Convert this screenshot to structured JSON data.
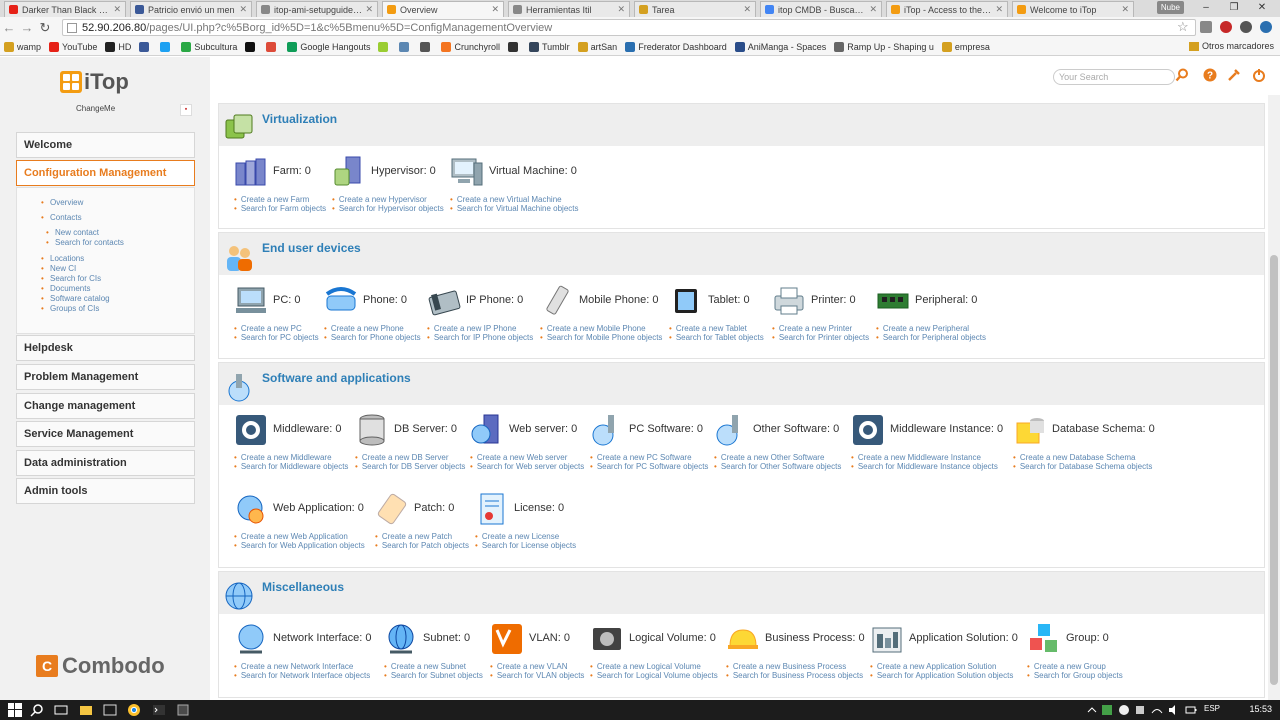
{
  "browser": {
    "tabs": [
      {
        "label": "Darker Than Black Oper",
        "color": "#e62117"
      },
      {
        "label": "Patricio envió un men",
        "color": "#3b5998"
      },
      {
        "label": "itop-ami-setupguide.pdf",
        "color": "#888888"
      },
      {
        "label": "Overview",
        "color": "#f39c12"
      },
      {
        "label": "Herramientas Itil",
        "color": "#888888"
      },
      {
        "label": "Tarea",
        "color": "#d4a020"
      },
      {
        "label": "itop CMDB - Buscar con",
        "color": "#4285f4"
      },
      {
        "label": "iTop - Access to the Der",
        "color": "#f39c12"
      },
      {
        "label": "Welcome to iTop",
        "color": "#f39c12"
      }
    ],
    "active_tab": 3,
    "user_chip": "Nube",
    "url_host": "52.90.206.80",
    "url_path": "/pages/UI.php?c%5Borg_id%5D=1&c%5Bmenu%5D=ConfigManagementOverview",
    "bookmarks": [
      {
        "label": "wamp",
        "color": "#d4a020"
      },
      {
        "label": "YouTube",
        "color": "#e62117"
      },
      {
        "label": "HD",
        "color": "#222222"
      },
      {
        "label": "",
        "color": "#3b5998"
      },
      {
        "label": "",
        "color": "#1da1f2"
      },
      {
        "label": "Subcultura",
        "color": "#2aa845"
      },
      {
        "label": "",
        "color": "#111111"
      },
      {
        "label": "",
        "color": "#dd4b39"
      },
      {
        "label": "Google Hangouts",
        "color": "#0f9d58"
      },
      {
        "label": "",
        "color": "#9acd32"
      },
      {
        "label": "",
        "color": "#5c87b2"
      },
      {
        "label": "",
        "color": "#555555"
      },
      {
        "label": "Crunchyroll",
        "color": "#f47521"
      },
      {
        "label": "",
        "color": "#333333"
      },
      {
        "label": "Tumblr",
        "color": "#35465c"
      },
      {
        "label": "artSan",
        "color": "#d4a020"
      },
      {
        "label": "Frederator Dashboard",
        "color": "#2a6fb0"
      },
      {
        "label": "AniManga - Spaces",
        "color": "#2a4d8a"
      },
      {
        "label": "Ramp Up - Shaping u",
        "color": "#666666"
      },
      {
        "label": "empresa",
        "color": "#d4a020"
      }
    ],
    "other_bookmarks": "Otros marcadores"
  },
  "sidebar": {
    "logo_text": "iTop",
    "org_name": "ChangeMe",
    "menus": [
      {
        "label": "Welcome",
        "active": false
      },
      {
        "label": "Configuration Management",
        "active": true
      },
      {
        "label": "Helpdesk",
        "active": false
      },
      {
        "label": "Problem Management",
        "active": false
      },
      {
        "label": "Change management",
        "active": false
      },
      {
        "label": "Service Management",
        "active": false
      },
      {
        "label": "Data administration",
        "active": false
      },
      {
        "label": "Admin tools",
        "active": false
      }
    ],
    "submenu": [
      "Overview",
      "Contacts",
      "New contact",
      "Search for contacts",
      "Locations",
      "New CI",
      "Search for CIs",
      "Documents",
      "Software catalog",
      "Groups of CIs"
    ],
    "footer_logo": "Combodo"
  },
  "topbar": {
    "search_placeholder": "Your Search"
  },
  "sections": [
    {
      "title": "Virtualization",
      "items": [
        {
          "label": "Farm: 0",
          "create": "Create a new Farm",
          "search": "Search for Farm objects"
        },
        {
          "label": "Hypervisor: 0",
          "create": "Create a new Hypervisor",
          "search": "Search for Hypervisor objects"
        },
        {
          "label": "Virtual Machine: 0",
          "create": "Create a new Virtual Machine",
          "search": "Search for Virtual Machine objects"
        }
      ]
    },
    {
      "title": "End user devices",
      "items": [
        {
          "label": "PC: 0",
          "create": "Create a new PC",
          "search": "Search for PC objects"
        },
        {
          "label": "Phone: 0",
          "create": "Create a new Phone",
          "search": "Search for Phone objects"
        },
        {
          "label": "IP Phone: 0",
          "create": "Create a new IP Phone",
          "search": "Search for IP Phone objects"
        },
        {
          "label": "Mobile Phone: 0",
          "create": "Create a new Mobile Phone",
          "search": "Search for Mobile Phone objects"
        },
        {
          "label": "Tablet: 0",
          "create": "Create a new Tablet",
          "search": "Search for Tablet objects"
        },
        {
          "label": "Printer: 0",
          "create": "Create a new Printer",
          "search": "Search for Printer objects"
        },
        {
          "label": "Peripheral: 0",
          "create": "Create a new Peripheral",
          "search": "Search for Peripheral objects"
        }
      ]
    },
    {
      "title": "Software and applications",
      "items": [
        {
          "label": "Middleware: 0",
          "create": "Create a new Middleware",
          "search": "Search for Middleware objects"
        },
        {
          "label": "DB Server: 0",
          "create": "Create a new DB Server",
          "search": "Search for DB Server objects"
        },
        {
          "label": "Web server: 0",
          "create": "Create a new Web server",
          "search": "Search for Web server objects"
        },
        {
          "label": "PC Software: 0",
          "create": "Create a new PC Software",
          "search": "Search for PC Software objects"
        },
        {
          "label": "Other Software: 0",
          "create": "Create a new Other Software",
          "search": "Search for Other Software objects"
        },
        {
          "label": "Middleware Instance: 0",
          "create": "Create a new Middleware Instance",
          "search": "Search for Middleware Instance objects"
        },
        {
          "label": "Database Schema: 0",
          "create": "Create a new Database Schema",
          "search": "Search for Database Schema objects"
        },
        {
          "label": "Web Application: 0",
          "create": "Create a new Web Application",
          "search": "Search for Web Application objects"
        },
        {
          "label": "Patch: 0",
          "create": "Create a new Patch",
          "search": "Search for Patch objects"
        },
        {
          "label": "License: 0",
          "create": "Create a new License",
          "search": "Search for License objects"
        }
      ]
    },
    {
      "title": "Miscellaneous",
      "items": [
        {
          "label": "Network Interface: 0",
          "create": "Create a new Network Interface",
          "search": "Search for Network Interface objects"
        },
        {
          "label": "Subnet: 0",
          "create": "Create a new Subnet",
          "search": "Search for Subnet objects"
        },
        {
          "label": "VLAN: 0",
          "create": "Create a new VLAN",
          "search": "Search for VLAN objects"
        },
        {
          "label": "Logical Volume: 0",
          "create": "Create a new Logical Volume",
          "search": "Search for Logical Volume objects"
        },
        {
          "label": "Business Process: 0",
          "create": "Create a new Business Process",
          "search": "Search for Business Process objects"
        },
        {
          "label": "Application Solution: 0",
          "create": "Create a new Application Solution",
          "search": "Search for Application Solution objects"
        },
        {
          "label": "Group: 0",
          "create": "Create a new Group",
          "search": "Search for Group objects"
        }
      ]
    }
  ],
  "taskbar": {
    "lang": "ESP",
    "clock": "15:53"
  }
}
